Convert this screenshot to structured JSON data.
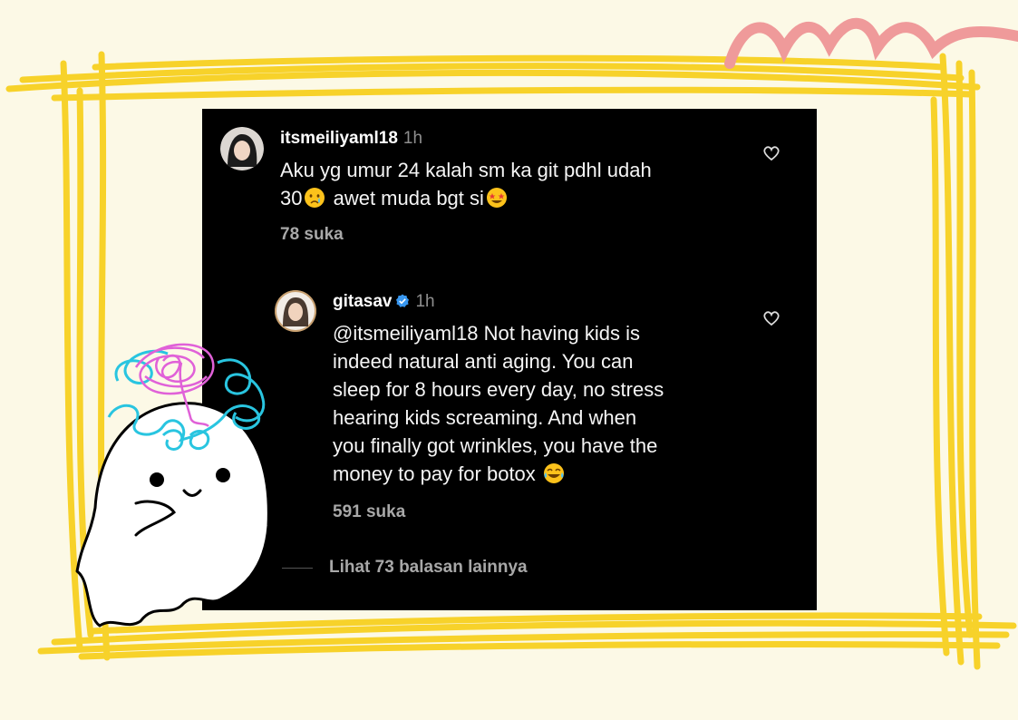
{
  "comments": [
    {
      "username": "itsmeiliyaml18",
      "time": "1h",
      "text_line1": "Aku yg umur 24 kalah sm ka git pdhl udah",
      "text_line2a": "30",
      "text_line2b": " awet muda bgt si",
      "emoji1": "crying-face",
      "emoji2": "star-struck-face",
      "likes": "78 suka"
    },
    {
      "username": "gitasav",
      "verified": true,
      "time": "1h",
      "lines": [
        "@itsmeiliyaml18 Not having kids is",
        "indeed natural anti aging. You can",
        "sleep for 8 hours every day, no stress",
        "hearing kids screaming. And when",
        "you finally got wrinkles, you have the"
      ],
      "last_line": "money to pay for botox ",
      "emoji": "tears-of-joy-face",
      "likes": "591 suka"
    }
  ],
  "view_more": "Lihat 73 balasan lainnya",
  "colors": {
    "background": "#fcf9e6",
    "frame": "#f7d22a",
    "squiggle": "#ef9a9a",
    "panel": "#000000",
    "verified": "#3897f0"
  }
}
